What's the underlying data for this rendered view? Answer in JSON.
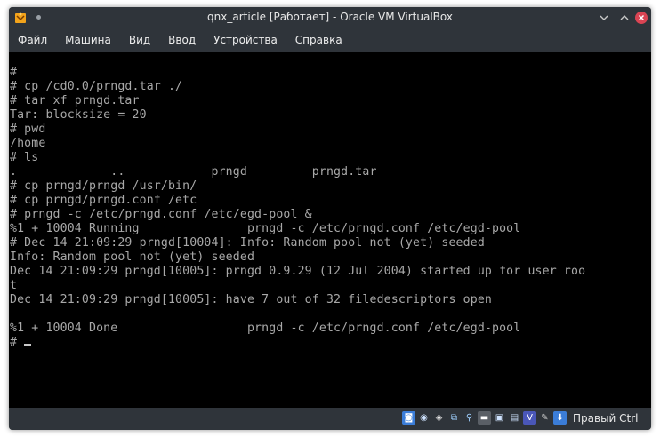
{
  "window": {
    "title": "qnx_article [Работает] - Oracle VM VirtualBox",
    "buttons": {
      "minimize": "⌃",
      "maximize": "⌃",
      "close": "✕"
    }
  },
  "menubar": {
    "items": [
      {
        "label": "Файл"
      },
      {
        "label": "Машина"
      },
      {
        "label": "Вид"
      },
      {
        "label": "Ввод"
      },
      {
        "label": "Устройства"
      },
      {
        "label": "Справка"
      }
    ]
  },
  "terminal": {
    "lines": [
      "#",
      "# cp /cd0.0/prngd.tar ./",
      "# tar xf prngd.tar",
      "Tar: blocksize = 20",
      "# pwd",
      "/home",
      "# ls",
      ".             ..            prngd         prngd.tar",
      "# cp prngd/prngd /usr/bin/",
      "# cp prngd/prngd.conf /etc",
      "# prngd -c /etc/prngd.conf /etc/egd-pool &",
      "%1 + 10004 Running               prngd -c /etc/prngd.conf /etc/egd-pool",
      "# Dec 14 21:09:29 prngd[10004]: Info: Random pool not (yet) seeded",
      "Info: Random pool not (yet) seeded",
      "Dec 14 21:09:29 prngd[10005]: prngd 0.9.29 (12 Jul 2004) started up for user roo",
      "t",
      "Dec 14 21:09:29 prngd[10005]: have 7 out of 32 filedescriptors open",
      "",
      "%1 + 10004 Done                  prngd -c /etc/prngd.conf /etc/egd-pool"
    ],
    "prompt": "# "
  },
  "statusbar": {
    "icons": [
      "hard-disk-icon",
      "optical-drive-icon",
      "audio-icon",
      "network-icon",
      "usb-icon",
      "shared-folders-icon",
      "display-icon",
      "video-capture-icon",
      "virtualization-icon",
      "mouse-integration-icon",
      "keyboard-icon"
    ],
    "host_key": "Правый Ctrl"
  },
  "colors": {
    "window_bg": "#2f343a",
    "terminal_fg": "#a8a8a8",
    "terminal_bg": "#000000",
    "close_button": "#da4453"
  }
}
